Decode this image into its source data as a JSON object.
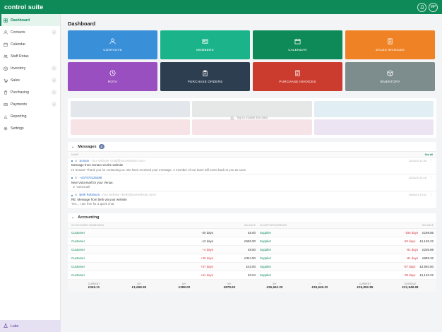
{
  "app": {
    "logo": "control suite",
    "user_initials": "MP"
  },
  "colors": {
    "brand": "#0e8a58",
    "labs_bg": "#e6e0f3"
  },
  "sidebar": {
    "items": [
      {
        "label": "Dashboard",
        "icon": "dashboard-icon",
        "active": true,
        "expandable": false
      },
      {
        "label": "Contacts",
        "icon": "contacts-icon",
        "active": false,
        "expandable": true
      },
      {
        "label": "Calendar",
        "icon": "calendar-icon",
        "active": false,
        "expandable": false
      },
      {
        "label": "Staff Rotas",
        "icon": "staff-icon",
        "active": false,
        "expandable": false
      },
      {
        "label": "Inventory",
        "icon": "inventory-icon",
        "active": false,
        "expandable": true
      },
      {
        "label": "Sales",
        "icon": "sales-icon",
        "active": false,
        "expandable": true
      },
      {
        "label": "Purchasing",
        "icon": "purchasing-icon",
        "active": false,
        "expandable": true
      },
      {
        "label": "Payments",
        "icon": "payments-icon",
        "active": false,
        "expandable": true
      },
      {
        "label": "Reporting",
        "icon": "reporting-icon",
        "active": false,
        "expandable": false
      },
      {
        "label": "Settings",
        "icon": "settings-icon",
        "active": false,
        "expandable": false
      }
    ],
    "labs_label": "Labs"
  },
  "main": {
    "title": "Dashboard",
    "tiles": [
      {
        "label": "CONTACTS",
        "color": "#3a8fd9",
        "icon": "contacts-icon"
      },
      {
        "label": "MEMBERS",
        "color": "#1bb48a",
        "icon": "members-icon"
      },
      {
        "label": "CALENDAR",
        "color": "#0e8a58",
        "icon": "calendar-icon"
      },
      {
        "label": "SALES INVOICES",
        "color": "#ef8224",
        "icon": "invoice-icon"
      },
      {
        "label": "ROTA",
        "color": "#9a4fc0",
        "icon": "clock-icon"
      },
      {
        "label": "PURCHASE ORDERS",
        "color": "#2c3e50",
        "icon": "clipboard-icon"
      },
      {
        "label": "PURCHASE INVOICES",
        "color": "#cb3b2e",
        "icon": "invoice-icon"
      },
      {
        "label": "INVENTORY",
        "color": "#7d8c8d",
        "icon": "box-icon"
      }
    ],
    "chart_hint": "Tap to enable live data",
    "chart_cells": [
      "#e3e6ea",
      "#e5e8e6",
      "#e1eef4",
      "#f7e3e5",
      "#f6e3e7",
      "#ece4f3"
    ]
  },
  "messages": {
    "title": "Messages",
    "count": "3",
    "col_label": "NAME",
    "see_all": "See all",
    "items": [
      {
        "from": "Sonam",
        "email": "Your website <mail@yourwebsite.com>",
        "date": "22/03/23 11:35",
        "subject": "Message from Sonam via the website",
        "body": "Hi Sonam! Thank you for contacting us. We have received your message. A member of our team will come back to you as soon"
      },
      {
        "from": "+447970125488",
        "email": "",
        "date": "22/03/23 11:18",
        "subject": "New Voicemail for your Venue.",
        "body": "Voicemail"
      },
      {
        "from": "Beth Robinson",
        "email": "Your website <beth@yourwebsite.com>",
        "date": "19/03/23 10:41",
        "subject": "RE: Message from beth via your website",
        "body": "Yes... I am free for a quick chat"
      }
    ]
  },
  "accounting": {
    "title": "Accounting",
    "headers": [
      "IN CUSTOMER SUBMISSION",
      "",
      "BALANCE",
      "IN SUPPLIER ARREARS",
      "BALANCE"
    ],
    "rows": [
      {
        "c_name": "Customer",
        "c_days": "-20 days",
        "c_bal": "£5.00",
        "s_name": "Supplier",
        "s_days": "-155 days",
        "s_bal": "£198.85"
      },
      {
        "c_name": "Customer",
        "c_days": "-12 days",
        "c_bal": "£550.00",
        "s_name": "Supplier",
        "s_days": "-92 days",
        "s_bal": "£1,165.22"
      },
      {
        "c_name": "Customer",
        "c_days": "+4 days",
        "c_bal": "£9.60",
        "s_name": "Supplier",
        "s_days": "-81 days",
        "s_bal": "£236.89"
      },
      {
        "c_name": "Customer",
        "c_days": "+26 days",
        "c_bal": "£324.50",
        "s_name": "Supplier",
        "s_days": "-81 days",
        "s_bal": "£699.32"
      },
      {
        "c_name": "Customer",
        "c_days": "+37 days",
        "c_bal": "£43.00",
        "s_name": "Supplier",
        "s_days": "-67 days",
        "s_bal": "£2,940.00"
      },
      {
        "c_name": "Customer",
        "c_days": "+61 days",
        "c_bal": "£0.04",
        "s_name": "Supplier",
        "s_days": "-39 days",
        "s_bal": "£1,140.22"
      }
    ],
    "totals": [
      {
        "label": "CURRENT",
        "value": "£349.11"
      },
      {
        "label": "30+",
        "value": "£1,658.99"
      },
      {
        "label": "60+",
        "value": "£389.00"
      },
      {
        "label": "90+",
        "value": "£878.60"
      },
      {
        "label": "30+",
        "value": "£35,662.20"
      },
      {
        "label": "7+",
        "value": "£35,549.32"
      },
      {
        "label": "CURRENT",
        "value": "£26,852.85"
      },
      {
        "label": "OVERDUE",
        "value": "£21,948.98"
      }
    ]
  }
}
